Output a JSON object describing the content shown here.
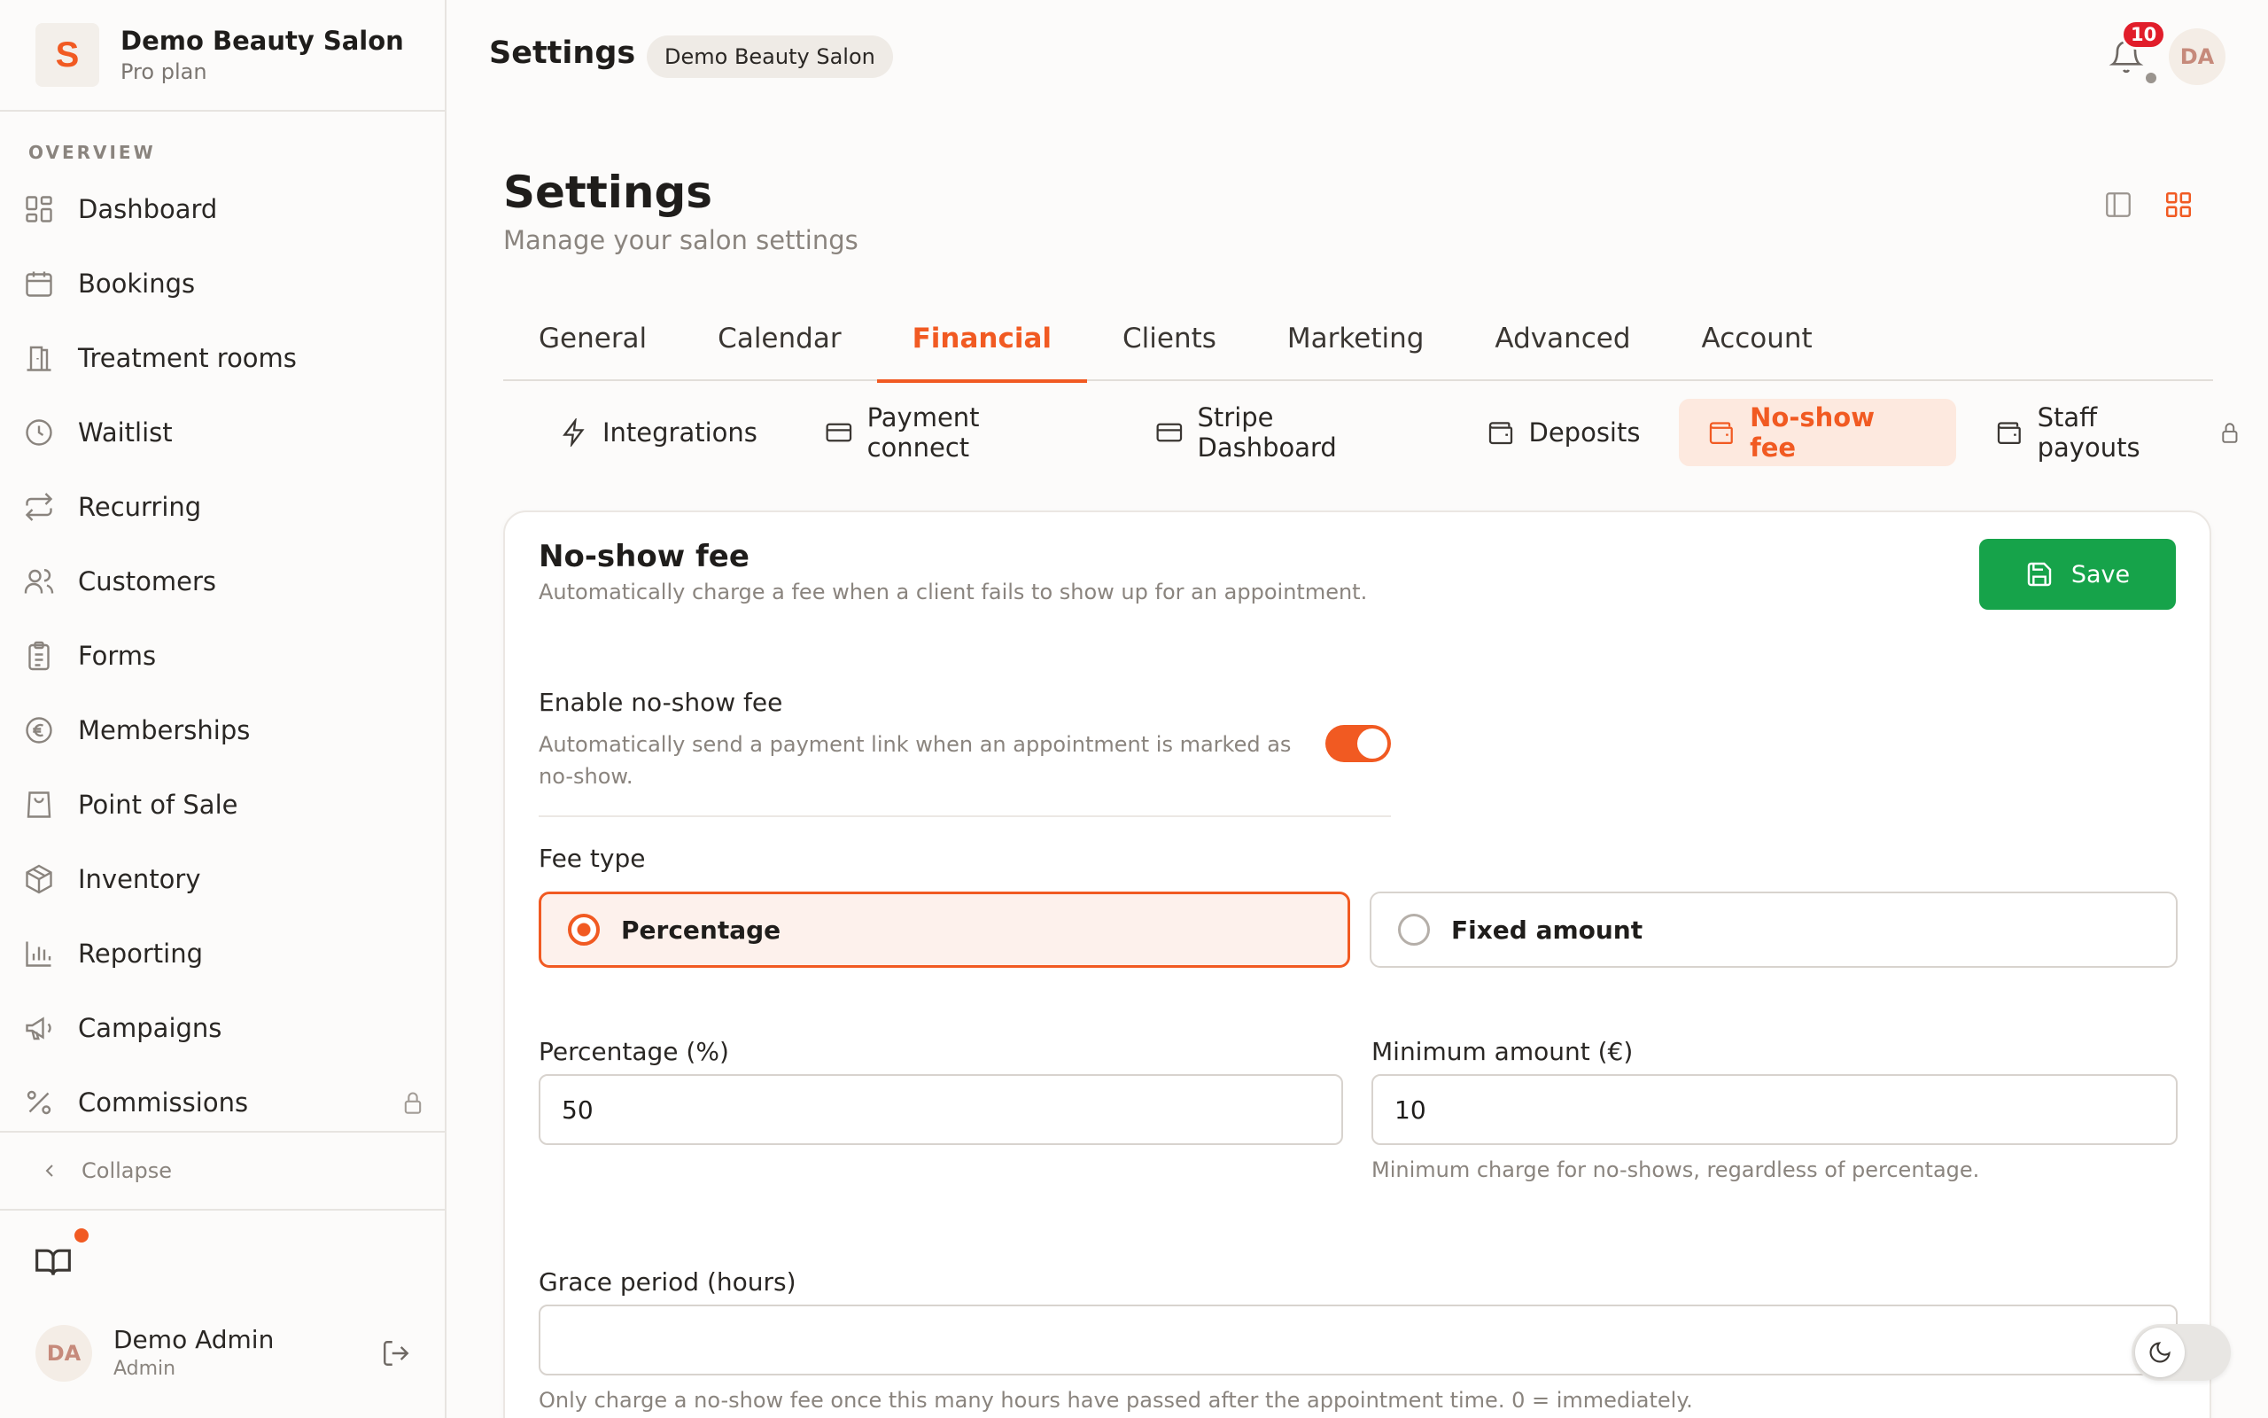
{
  "brand": {
    "name": "Demo Beauty Salon",
    "plan": "Pro plan",
    "logo_letter": "S",
    "accent": "#f15a22"
  },
  "sidebar": {
    "section": "OVERVIEW",
    "items": [
      {
        "label": "Dashboard",
        "icon": "dashboard-icon"
      },
      {
        "label": "Bookings",
        "icon": "calendar-icon"
      },
      {
        "label": "Treatment rooms",
        "icon": "door-icon"
      },
      {
        "label": "Waitlist",
        "icon": "clock-icon"
      },
      {
        "label": "Recurring",
        "icon": "repeat-icon"
      },
      {
        "label": "Customers",
        "icon": "users-icon"
      },
      {
        "label": "Forms",
        "icon": "clipboard-icon"
      },
      {
        "label": "Memberships",
        "icon": "euro-icon"
      },
      {
        "label": "Point of Sale",
        "icon": "shopping-bag-icon"
      },
      {
        "label": "Inventory",
        "icon": "package-icon"
      },
      {
        "label": "Reporting",
        "icon": "bar-chart-icon"
      },
      {
        "label": "Campaigns",
        "icon": "megaphone-icon"
      },
      {
        "label": "Commissions",
        "icon": "percent-icon",
        "locked": true
      }
    ],
    "collapse": "Collapse",
    "user": {
      "initials": "DA",
      "name": "Demo Admin",
      "role": "Admin"
    }
  },
  "topbar": {
    "title": "Settings",
    "badge": "Demo Beauty Salon",
    "notifications": "10",
    "avatar": "DA"
  },
  "page": {
    "title": "Settings",
    "subtitle": "Manage your salon settings"
  },
  "tabs": [
    {
      "label": "General",
      "active": false
    },
    {
      "label": "Calendar",
      "active": false
    },
    {
      "label": "Financial",
      "active": true
    },
    {
      "label": "Clients",
      "active": false
    },
    {
      "label": "Marketing",
      "active": false
    },
    {
      "label": "Advanced",
      "active": false
    },
    {
      "label": "Account",
      "active": false
    }
  ],
  "subtabs": [
    {
      "label": "Integrations",
      "icon": "zap-icon"
    },
    {
      "label": "Payment connect",
      "icon": "credit-card-icon"
    },
    {
      "label": "Stripe Dashboard",
      "icon": "credit-card-icon"
    },
    {
      "label": "Deposits",
      "icon": "wallet-icon"
    },
    {
      "label": "No-show fee",
      "icon": "wallet-icon",
      "active": true
    },
    {
      "label": "Staff payouts",
      "icon": "wallet-icon",
      "locked": true
    }
  ],
  "card": {
    "title": "No-show fee",
    "description": "Automatically charge a fee when a client fails to show up for an appointment.",
    "save": "Save",
    "enable": {
      "label": "Enable no-show fee",
      "help_line1": "Automatically send a payment link when an appointment is marked as",
      "help_line2": "no-show.",
      "enabled": true
    },
    "fee_type": {
      "label": "Fee type",
      "options": [
        "Percentage",
        "Fixed amount"
      ],
      "selected": "Percentage"
    },
    "percentage": {
      "label": "Percentage (%)",
      "value": "50"
    },
    "minimum": {
      "label": "Minimum amount (€)",
      "value": "10",
      "help": "Minimum charge for no-shows, regardless of percentage."
    },
    "grace": {
      "label": "Grace period (hours)",
      "value": "",
      "help": "Only charge a no-show fee once this many hours have passed after the appointment time. 0 = immediately."
    }
  },
  "colors": {
    "accent": "#f15a22",
    "save": "#16a34a",
    "badge": "#e11d2a"
  }
}
